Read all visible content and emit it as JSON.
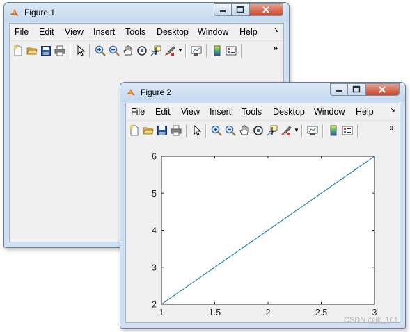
{
  "windows": [
    {
      "title": "Figure 1",
      "menu": [
        "File",
        "Edit",
        "View",
        "Insert",
        "Tools",
        "Desktop",
        "Window",
        "Help"
      ]
    },
    {
      "title": "Figure 2",
      "menu": [
        "File",
        "Edit",
        "View",
        "Insert",
        "Tools",
        "Desktop",
        "Window",
        "Help"
      ]
    }
  ],
  "toolbar_icons": [
    "new-figure-icon",
    "open-file-icon",
    "save-icon",
    "print-icon",
    "edit-plot-arrow-icon",
    "zoom-in-icon",
    "zoom-out-icon",
    "pan-hand-icon",
    "rotate-3d-icon",
    "data-cursor-icon",
    "brush-icon",
    "brush-dropdown-icon",
    "link-plot-icon",
    "colorbar-icon",
    "legend-icon",
    "more-chevron-icon"
  ],
  "colors": {
    "plot_line": "#0072bd",
    "window_frame": "#cfe0f1",
    "close_button": "#c7462d"
  },
  "chart_data": {
    "type": "line",
    "x": [
      1,
      3
    ],
    "series": [
      {
        "values": [
          2,
          6
        ]
      }
    ],
    "xlim": [
      1,
      3
    ],
    "ylim": [
      2,
      6
    ],
    "xticks": [
      "1",
      "1.5",
      "2",
      "2.5",
      "3"
    ],
    "yticks": [
      "2",
      "3",
      "4",
      "5",
      "6"
    ],
    "grid": false,
    "title": "",
    "xlabel": "",
    "ylabel": ""
  },
  "watermark": "CSDN @jk_101"
}
